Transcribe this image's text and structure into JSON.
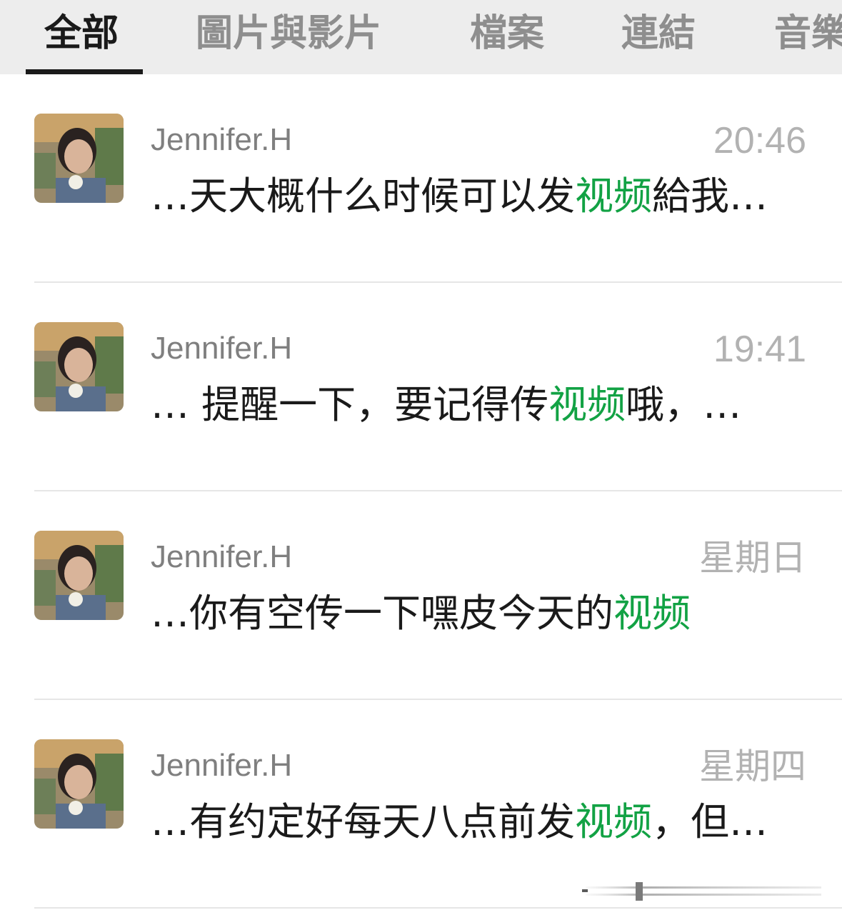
{
  "tabs": [
    {
      "label": "全部",
      "active": true
    },
    {
      "label": "圖片與影片"
    },
    {
      "label": "檔案"
    },
    {
      "label": "連結"
    },
    {
      "label": "音樂"
    }
  ],
  "results": [
    {
      "sender": "Jennifer.H",
      "time": "20:46",
      "snippet_before": "…天大概什么时候可以发",
      "highlight": "视频",
      "snippet_after": "給我…"
    },
    {
      "sender": "Jennifer.H",
      "time": "19:41",
      "snippet_before": "… 提醒一下，要记得传",
      "highlight": "视频",
      "snippet_after": "哦，…"
    },
    {
      "sender": "Jennifer.H",
      "time": "星期日",
      "snippet_before": "…你有空传一下嘿皮今天的",
      "highlight": "视频",
      "snippet_after": ""
    },
    {
      "sender": "Jennifer.H",
      "time": "星期四",
      "snippet_before": "…有约定好每天八点前发",
      "highlight": "视频",
      "snippet_after": "，但…"
    }
  ],
  "colors": {
    "highlight": "#12a244",
    "tabbar_bg": "#ededed",
    "active_tab": "#1a1a1a",
    "inactive_tab": "#8e8e8e",
    "time": "#b2b2b2",
    "sender": "#7f7f7f"
  }
}
